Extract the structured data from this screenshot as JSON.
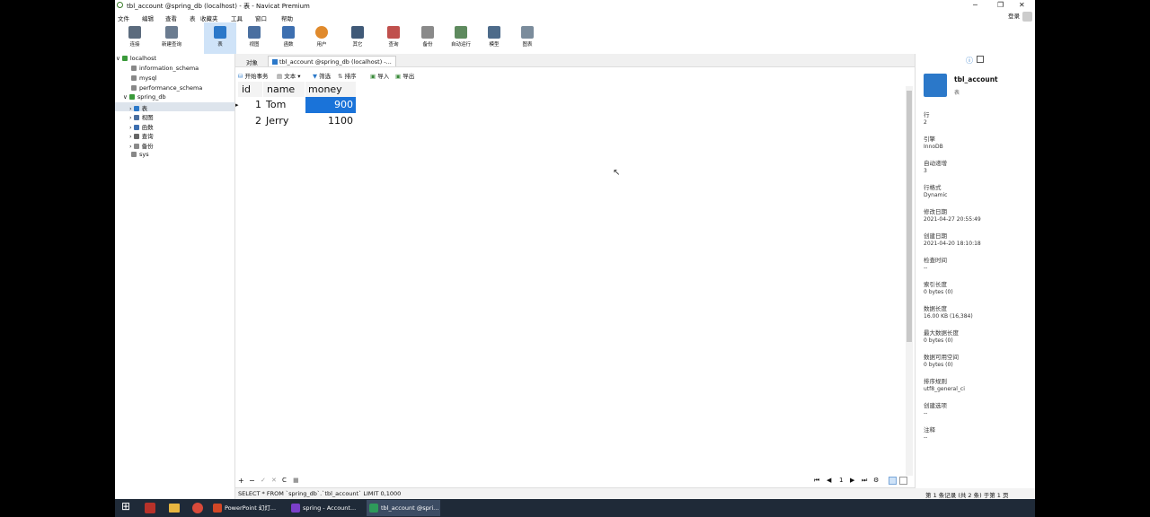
{
  "window": {
    "title": "tbl_account @spring_db (localhost) - 表 - Navicat Premium",
    "min": "─",
    "max": "❐",
    "close": "✕"
  },
  "menu": [
    "文件",
    "编辑",
    "查看",
    "表",
    "收藏夹",
    "工具",
    "窗口",
    "帮助"
  ],
  "login": "登录",
  "ribbon": [
    {
      "label": "连接",
      "icon": "connection-icon"
    },
    {
      "label": "新建查询",
      "icon": "new-query-icon"
    },
    {
      "label": "表",
      "icon": "table-icon"
    },
    {
      "label": "视图",
      "icon": "view-icon"
    },
    {
      "label": "函数",
      "icon": "function-icon"
    },
    {
      "label": "用户",
      "icon": "user-icon"
    },
    {
      "label": "其它",
      "icon": "other-icon"
    },
    {
      "label": "查询",
      "icon": "query-icon"
    },
    {
      "label": "备份",
      "icon": "backup-icon"
    },
    {
      "label": "自动运行",
      "icon": "automation-icon"
    },
    {
      "label": "模型",
      "icon": "model-icon"
    },
    {
      "label": "图表",
      "icon": "chart-icon"
    }
  ],
  "tree": {
    "root": "localhost",
    "dbs": [
      "information_schema",
      "mysql",
      "performance_schema",
      "spring_db",
      "sys"
    ],
    "children": [
      "表",
      "视图",
      "函数",
      "查询",
      "备份"
    ]
  },
  "tabs": [
    "对象",
    "tbl_account @spring_db (localhost) -..."
  ],
  "toolbar": [
    "开始事务",
    "文本",
    "筛选",
    "排序",
    "导入",
    "导出"
  ],
  "grid": {
    "columns": [
      "id",
      "name",
      "money"
    ],
    "rows": [
      {
        "id": "1",
        "name": "Tom",
        "money": "900"
      },
      {
        "id": "2",
        "name": "Jerry",
        "money": "1100"
      }
    ]
  },
  "bottom": {
    "plus": "+",
    "minus": "−",
    "check": "✓",
    "cross": "✕",
    "refresh": "C",
    "stop": "■",
    "first": "⏮",
    "prev": "◀",
    "page": "1",
    "next": "▶",
    "last": "⏭",
    "settings": "⚙"
  },
  "status": {
    "sql": "SELECT * FROM `spring_db`.`tbl_account` LIMIT 0,1000",
    "right": "第 1 条记录 (共 2 条) 于第 1 页"
  },
  "info": {
    "name": "tbl_account",
    "type": "表",
    "fields": [
      {
        "k": "行",
        "v": "2"
      },
      {
        "k": "引擎",
        "v": "InnoDB"
      },
      {
        "k": "自动递增",
        "v": "3"
      },
      {
        "k": "行格式",
        "v": "Dynamic"
      },
      {
        "k": "修改日期",
        "v": "2021-04-27 20:55:49"
      },
      {
        "k": "创建日期",
        "v": "2021-04-20 18:10:18"
      },
      {
        "k": "检查时间",
        "v": "--"
      },
      {
        "k": "索引长度",
        "v": "0 bytes (0)"
      },
      {
        "k": "数据长度",
        "v": "16.00 KB (16,384)"
      },
      {
        "k": "最大数据长度",
        "v": "0 bytes (0)"
      },
      {
        "k": "数据可用空间",
        "v": "0 bytes (0)"
      },
      {
        "k": "排序规则",
        "v": "utf8_general_ci"
      },
      {
        "k": "创建选项",
        "v": "--"
      },
      {
        "k": "注释",
        "v": "--"
      }
    ]
  },
  "taskbar": {
    "apps": [
      "PowerPoint 幻灯...",
      "spring - Account...",
      "tbl_account @spri..."
    ],
    "start": "⊞"
  },
  "colors": {
    "selected_cell": "#1a73d9",
    "accent": "#2b78c9",
    "taskbar": "#1f2a38"
  }
}
